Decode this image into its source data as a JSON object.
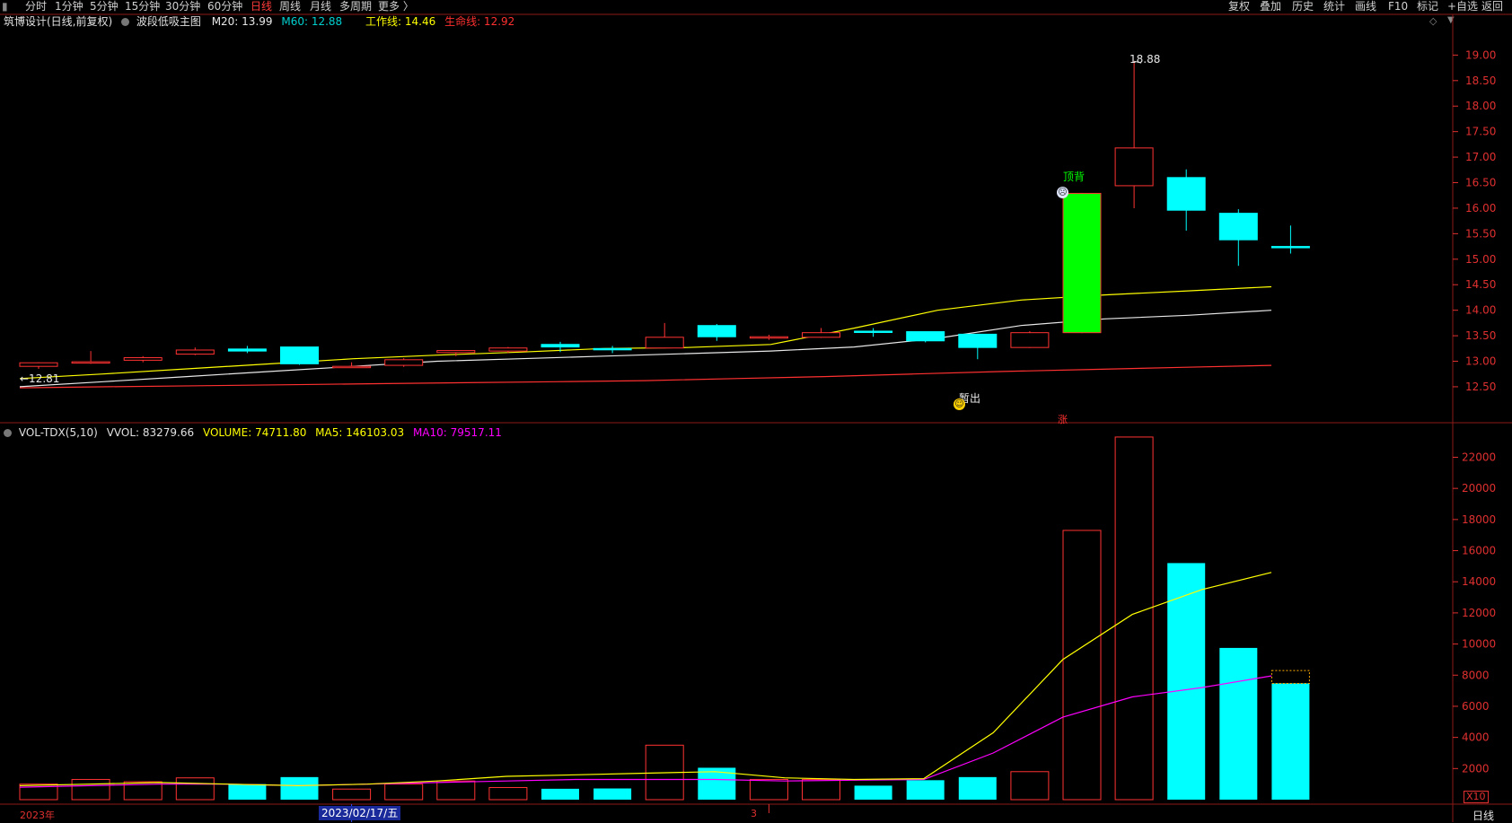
{
  "toolbar": {
    "periods": [
      "分时",
      "1分钟",
      "5分钟",
      "15分钟",
      "30分钟",
      "60分钟",
      "日线",
      "周线",
      "月线",
      "多周期",
      "更多 〉"
    ],
    "active_period": "日线",
    "right_tools": [
      "复权",
      "叠加",
      "历史",
      "统计",
      "画线",
      "F10",
      "标记",
      "+自选",
      "返回"
    ]
  },
  "main_legend": {
    "stock": "筑博设计(日线,前复权)",
    "indicator": "波段低吸主图",
    "m20": "M20: 13.99",
    "m60": "M60: 12.88",
    "work_line": "工作线: 14.46",
    "life_line": "生命线: 12.92"
  },
  "vol_legend": {
    "name": "VOL-TDX(5,10)",
    "vvol": "VVOL: 83279.66",
    "volume": "VOLUME: 74711.80",
    "ma5": "MA5: 146103.03",
    "ma10": "MA10: 79517.11"
  },
  "annotations": {
    "high_label": "18.88",
    "low_label": "←12.81",
    "top_signal": "顶背",
    "exit_signal": "暂出",
    "zhang_signal": "涨"
  },
  "price_axis": [
    "19.00",
    "18.50",
    "18.00",
    "17.50",
    "17.00",
    "16.50",
    "16.00",
    "15.50",
    "15.00",
    "14.50",
    "14.00",
    "13.50",
    "13.00",
    "12.50"
  ],
  "vol_axis": [
    "22000",
    "20000",
    "18000",
    "16000",
    "14000",
    "12000",
    "10000",
    "8000",
    "6000",
    "4000",
    "2000"
  ],
  "vol_unit": "X10",
  "date_axis": {
    "year": "2023年",
    "cursor_date": "2023/02/17/五",
    "month_mark": "3"
  },
  "period_label": "日线",
  "colors": {
    "up": "#ff3333",
    "down": "#00ffff",
    "limit_up": "#00ff00",
    "ma_white": "#e8e8e8",
    "ma_yellow": "#ffff00",
    "ma_red": "#ff3030",
    "vol_ma5": "#ffff00",
    "vol_ma10": "#ff00ff"
  },
  "chart_data": {
    "type": "candlestick",
    "candles": [
      {
        "o": 12.9,
        "h": 12.98,
        "l": 12.85,
        "c": 12.97,
        "vol": 1000
      },
      {
        "o": 12.98,
        "h": 13.2,
        "l": 12.95,
        "c": 12.99,
        "vol": 1300
      },
      {
        "o": 13.02,
        "h": 13.1,
        "l": 12.98,
        "c": 13.07,
        "vol": 1150
      },
      {
        "o": 13.14,
        "h": 13.27,
        "l": 13.12,
        "c": 13.22,
        "vol": 1400
      },
      {
        "o": 13.24,
        "h": 13.3,
        "l": 13.16,
        "c": 13.2,
        "vol": 1000
      },
      {
        "o": 13.28,
        "h": 13.28,
        "l": 12.93,
        "c": 12.95,
        "vol": 1450
      },
      {
        "o": 12.9,
        "h": 12.98,
        "l": 12.88,
        "c": 12.9,
        "vol": 680
      },
      {
        "o": 12.92,
        "h": 13.06,
        "l": 12.89,
        "c": 13.03,
        "vol": 1000
      },
      {
        "o": 13.17,
        "h": 13.22,
        "l": 13.1,
        "c": 13.21,
        "vol": 1200
      },
      {
        "o": 13.2,
        "h": 13.28,
        "l": 13.16,
        "c": 13.26,
        "vol": 780
      },
      {
        "o": 13.33,
        "h": 13.38,
        "l": 13.18,
        "c": 13.28,
        "vol": 700
      },
      {
        "o": 13.25,
        "h": 13.3,
        "l": 13.16,
        "c": 13.24,
        "vol": 720
      },
      {
        "o": 13.26,
        "h": 13.75,
        "l": 13.25,
        "c": 13.47,
        "vol": 3500
      },
      {
        "o": 13.7,
        "h": 13.73,
        "l": 13.4,
        "c": 13.48,
        "vol": 2050
      },
      {
        "o": 13.46,
        "h": 13.52,
        "l": 13.42,
        "c": 13.48,
        "vol": 1300
      },
      {
        "o": 13.47,
        "h": 13.65,
        "l": 13.46,
        "c": 13.56,
        "vol": 1300
      },
      {
        "o": 13.59,
        "h": 13.65,
        "l": 13.48,
        "c": 13.57,
        "vol": 900
      },
      {
        "o": 13.58,
        "h": 13.58,
        "l": 13.37,
        "c": 13.4,
        "vol": 1250
      },
      {
        "o": 13.53,
        "h": 13.53,
        "l": 13.04,
        "c": 13.27,
        "vol": 1450
      },
      {
        "o": 13.27,
        "h": 13.59,
        "l": 13.26,
        "c": 13.56,
        "vol": 1800
      },
      {
        "o": 13.56,
        "h": 16.3,
        "l": 13.55,
        "c": 16.29,
        "vol": 17300
      },
      {
        "o": 16.44,
        "h": 18.88,
        "l": 16.0,
        "c": 17.18,
        "vol": 23300
      },
      {
        "o": 16.6,
        "h": 16.76,
        "l": 15.56,
        "c": 15.96,
        "vol": 15200
      },
      {
        "o": 15.9,
        "h": 15.98,
        "l": 14.87,
        "c": 15.38,
        "vol": 9750
      },
      {
        "o": 15.25,
        "h": 15.66,
        "l": 15.11,
        "c": 15.24,
        "vol": 7470
      }
    ],
    "limit_up_index": 20,
    "ma_white": [
      12.5,
      12.6,
      12.7,
      12.8,
      12.9,
      13.0,
      13.05,
      13.1,
      13.15,
      13.2,
      13.28,
      13.45,
      13.7,
      13.83,
      13.9,
      14.0
    ],
    "ma_yellow": [
      12.66,
      12.75,
      12.85,
      12.95,
      13.05,
      13.12,
      13.18,
      13.25,
      13.27,
      13.33,
      13.65,
      14.0,
      14.2,
      14.3,
      14.38,
      14.46
    ],
    "ma_red": [
      12.48,
      12.5,
      12.52,
      12.54,
      12.56,
      12.58,
      12.6,
      12.62,
      12.66,
      12.7,
      12.75,
      12.8,
      12.84,
      12.88,
      12.92
    ],
    "vol_ma5": [
      900,
      1000,
      1100,
      1000,
      900,
      1000,
      1200,
      1500,
      1600,
      1700,
      1800,
      1400,
      1300,
      1350,
      4300,
      9000,
      11900,
      13500,
      14600
    ],
    "vol_ma10": [
      800,
      900,
      1000,
      1000,
      900,
      1000,
      1100,
      1200,
      1300,
      1300,
      1300,
      1200,
      1250,
      1300,
      3000,
      5300,
      6600,
      7200,
      7950
    ],
    "y_range": [
      12.2,
      19.2
    ],
    "vol_range": [
      0,
      23700
    ]
  }
}
